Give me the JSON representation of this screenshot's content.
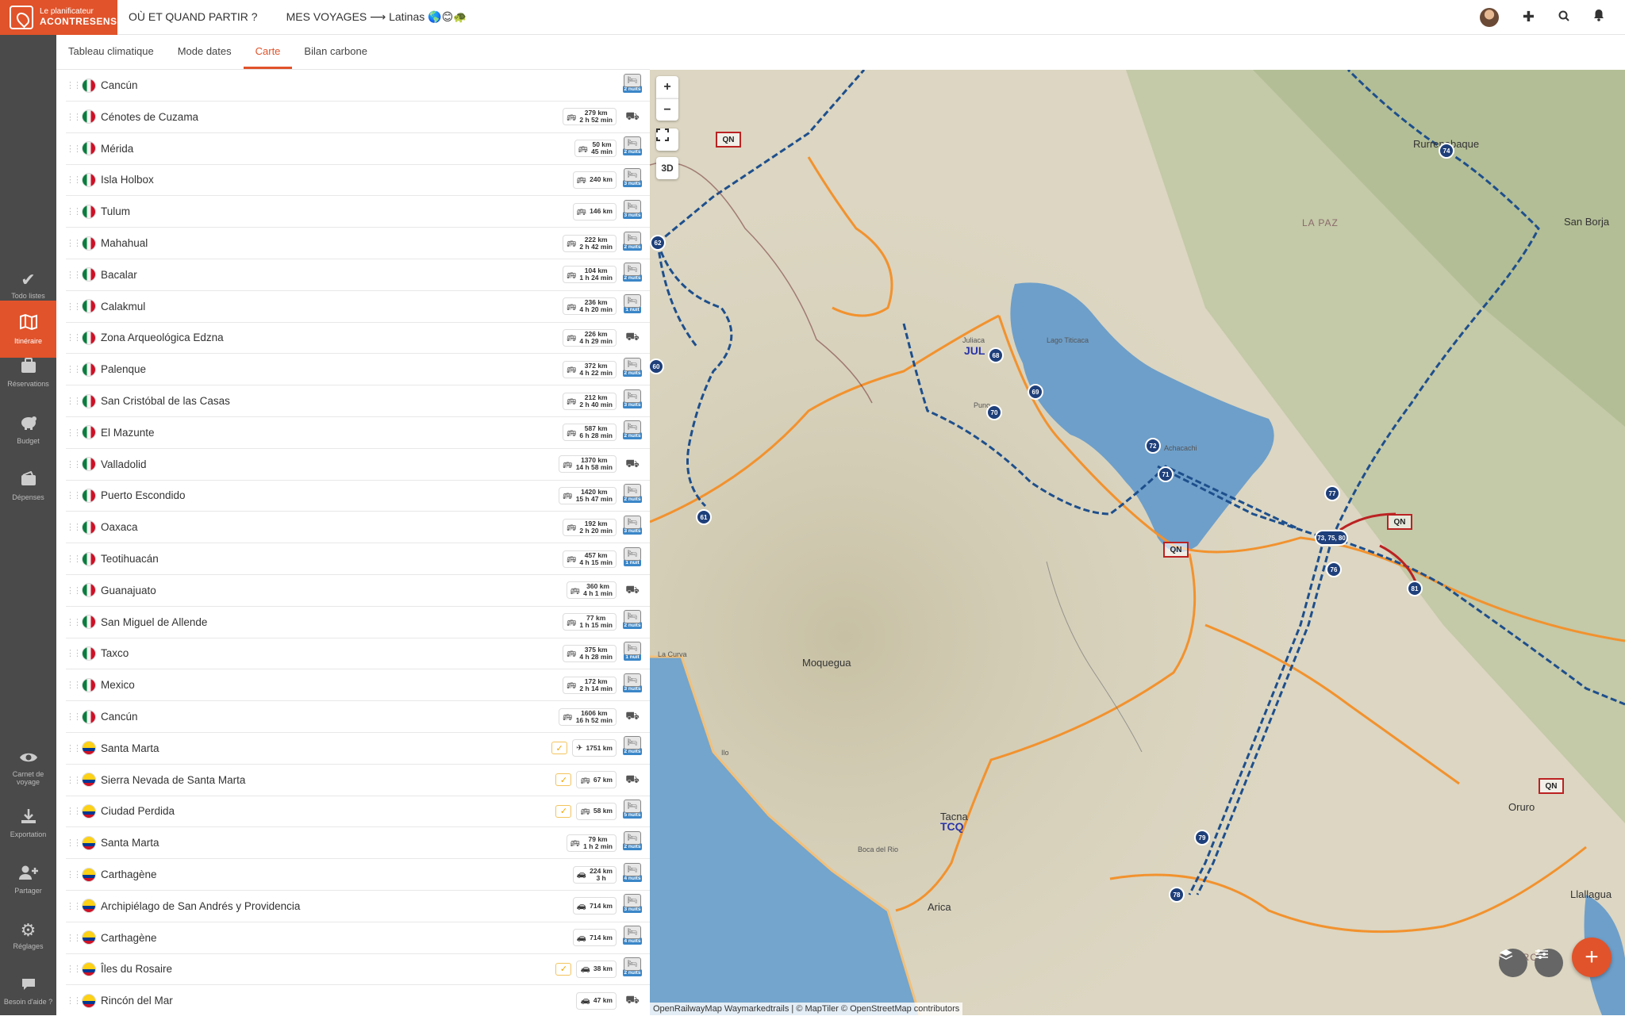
{
  "app": {
    "logo_line1": "Le planificateur",
    "logo_line2": "ACONTRESENS"
  },
  "topnav": {
    "where_when": "OÙ ET QUAND PARTIR ?",
    "my_trips": "MES VOYAGES ⟶ Latinas 🌎😊🐢"
  },
  "topbar_icons": [
    "avatar",
    "plus-icon",
    "search-icon",
    "bell-icon"
  ],
  "sidebar": {
    "items": [
      {
        "label": "Todo listes",
        "icon": "check-icon"
      },
      {
        "label": "Itinéraire",
        "icon": "map-icon",
        "active": true
      },
      {
        "label": "Réservations",
        "icon": "suitcase-icon"
      },
      {
        "label": "Budget",
        "icon": "piggy-bank-icon"
      },
      {
        "label": "Dépenses",
        "icon": "wallet-icon"
      },
      {
        "label": "Carnet de voyage",
        "icon": "eye-icon"
      },
      {
        "label": "Exportation",
        "icon": "download-icon"
      },
      {
        "label": "Partager",
        "icon": "add-user-icon"
      },
      {
        "label": "Réglages",
        "icon": "gear-icon"
      },
      {
        "label": "Besoin d'aide ?",
        "icon": "chat-icon"
      }
    ]
  },
  "tabs": [
    {
      "label": "Tableau climatique"
    },
    {
      "label": "Mode dates"
    },
    {
      "label": "Carte",
      "active": true
    },
    {
      "label": "Bilan carbone"
    }
  ],
  "colors": {
    "brand": "#e1532a",
    "green": "#7bbf5a",
    "yellow": "#f4e04d",
    "orange": "#f0a35a",
    "red": "#e25b4a",
    "route_blue": "#1e4f8c",
    "route_orange": "#f2922e"
  },
  "itinerary": [
    {
      "place": "Cancún",
      "flag": "mx",
      "check": false,
      "transport": null,
      "dist": "",
      "time": "",
      "nights": "2 nuits",
      "num": "1",
      "color": "#f6ec8a",
      "numcolor": "#8a7a1a"
    },
    {
      "place": "Cénotes de Cuzama",
      "flag": "mx",
      "check": false,
      "transport": "bus",
      "dist": "279 km",
      "time": "2 h 52 min",
      "nights": "",
      "num": "2",
      "color": "#7bbf5a"
    },
    {
      "place": "Mérida",
      "flag": "mx",
      "check": false,
      "transport": "bus",
      "dist": "50 km",
      "time": "45 min",
      "nights": "2 nuits",
      "num": "3",
      "color": "#7bbf5a"
    },
    {
      "place": "Isla Holbox",
      "flag": "mx",
      "check": false,
      "transport": "bus",
      "dist": "240 km",
      "time": "",
      "nights": "3 nuits",
      "num": "4",
      "color": "#9fd08a"
    },
    {
      "place": "Tulum",
      "flag": "mx",
      "check": false,
      "transport": "bus",
      "dist": "146 km",
      "time": "",
      "nights": "3 nuits",
      "num": "5",
      "color": "#9fd08a"
    },
    {
      "place": "Mahahual",
      "flag": "mx",
      "check": false,
      "transport": "bus",
      "dist": "222 km",
      "time": "2 h 42 min",
      "nights": "2 nuits",
      "num": "6",
      "color": "#7bbf5a"
    },
    {
      "place": "Bacalar",
      "flag": "mx",
      "check": false,
      "transport": "bus",
      "dist": "104 km",
      "time": "1 h 24 min",
      "nights": "2 nuits",
      "num": "7",
      "color": "#7bbf5a"
    },
    {
      "place": "Calakmul",
      "flag": "mx",
      "check": false,
      "transport": "bus",
      "dist": "236 km",
      "time": "4 h 20 min",
      "nights": "1 nuit",
      "num": "8",
      "color": "#7bbf5a"
    },
    {
      "place": "Zona Arqueológica Edzna",
      "flag": "mx",
      "check": false,
      "transport": "bus",
      "dist": "226 km",
      "time": "4 h 29 min",
      "nights": "",
      "num": "9",
      "color": "#7bbf5a"
    },
    {
      "place": "Palenque",
      "flag": "mx",
      "check": false,
      "transport": "bus",
      "dist": "372 km",
      "time": "4 h 22 min",
      "nights": "2 nuits",
      "num": "10",
      "color": "#7bbf5a"
    },
    {
      "place": "San Cristóbal de las Casas",
      "flag": "mx",
      "check": false,
      "transport": "bus",
      "dist": "212 km",
      "time": "2 h 40 min",
      "nights": "3 nuits",
      "num": "11",
      "color": "#f6ec8a",
      "numcolor": "#8a7a1a"
    },
    {
      "place": "El Mazunte",
      "flag": "mx",
      "check": false,
      "transport": "bus",
      "dist": "587 km",
      "time": "6 h 28 min",
      "nights": "2 nuits",
      "num": "12",
      "color": "#7bbf5a"
    },
    {
      "place": "Valladolid",
      "flag": "mx",
      "check": false,
      "transport": "bus",
      "dist": "1370 km",
      "time": "14 h 58 min",
      "nights": "",
      "num": "13",
      "color": "#7bbf5a"
    },
    {
      "place": "Puerto Escondido",
      "flag": "mx",
      "check": false,
      "transport": "bus",
      "dist": "1420 km",
      "time": "15 h 47 min",
      "nights": "2 nuits",
      "num": "14",
      "color": "#7bbf5a"
    },
    {
      "place": "Oaxaca",
      "flag": "mx",
      "check": false,
      "transport": "bus",
      "dist": "192 km",
      "time": "2 h 20 min",
      "nights": "3 nuits",
      "num": "15",
      "color": "#9fd08a"
    },
    {
      "place": "Teotihuacán",
      "flag": "mx",
      "check": false,
      "transport": "bus",
      "dist": "457 km",
      "time": "4 h 15 min",
      "nights": "1 nuit",
      "num": "16",
      "color": "#e25b4a"
    },
    {
      "place": "Guanajuato",
      "flag": "mx",
      "check": false,
      "transport": "bus",
      "dist": "360 km",
      "time": "4 h 1 min",
      "nights": "",
      "num": "17",
      "color": "#f0a35a"
    },
    {
      "place": "San Miguel de Allende",
      "flag": "mx",
      "check": false,
      "transport": "bus",
      "dist": "77 km",
      "time": "1 h 15 min",
      "nights": "2 nuits",
      "num": "18",
      "color": "#f0a35a"
    },
    {
      "place": "Taxco",
      "flag": "mx",
      "check": false,
      "transport": "bus",
      "dist": "375 km",
      "time": "4 h 28 min",
      "nights": "1 nuit",
      "num": "19",
      "color": "#7bbf5a"
    },
    {
      "place": "Mexico",
      "flag": "mx",
      "check": false,
      "transport": "bus",
      "dist": "172 km",
      "time": "2 h 14 min",
      "nights": "3 nuits",
      "num": "20",
      "color": "#f6ec8a",
      "numcolor": "#8a7a1a"
    },
    {
      "place": "Cancún",
      "flag": "mx",
      "check": false,
      "transport": "bus",
      "dist": "1606 km",
      "time": "16 h 52 min",
      "nights": "",
      "num": "21",
      "color": "#f6ec8a",
      "numcolor": "#8a7a1a"
    },
    {
      "place": "Santa Marta",
      "flag": "co",
      "check": true,
      "transport": "plane",
      "dist": "1751 km",
      "time": "",
      "nights": "2 nuits",
      "num": "22",
      "color": "#7bbf5a"
    },
    {
      "place": "Sierra Nevada de Santa Marta",
      "flag": "co",
      "check": true,
      "transport": "bus",
      "dist": "67 km",
      "time": "",
      "nights": "",
      "num": "23",
      "color": "#7bbf5a"
    },
    {
      "place": "Ciudad Perdida",
      "flag": "co",
      "check": true,
      "transport": "bus",
      "dist": "58 km",
      "time": "",
      "nights": "5 nuits",
      "num": "24",
      "color": "#7bbf5a"
    },
    {
      "place": "Santa Marta",
      "flag": "co",
      "check": false,
      "transport": "bus",
      "dist": "79 km",
      "time": "1 h 2 min",
      "nights": "2 nuits",
      "num": "25",
      "color": "#7bbf5a"
    },
    {
      "place": "Carthagène",
      "flag": "co",
      "check": false,
      "transport": "car",
      "dist": "224 km",
      "time": "3 h",
      "nights": "4 nuits",
      "num": "26",
      "color": "#7bbf5a"
    },
    {
      "place": "Archipiélago de San Andrés y Providencia",
      "flag": "co",
      "check": false,
      "transport": "car",
      "dist": "714 km",
      "time": "",
      "nights": "3 nuits",
      "num": "27",
      "color": "#7bbf5a"
    },
    {
      "place": "Carthagène",
      "flag": "co",
      "check": false,
      "transport": "car",
      "dist": "714 km",
      "time": "",
      "nights": "4 nuits",
      "num": "28",
      "color": "#7bbf5a"
    },
    {
      "place": "Îles du Rosaire",
      "flag": "co",
      "check": true,
      "transport": "car",
      "dist": "38 km",
      "time": "",
      "nights": "2 nuits",
      "num": "29",
      "color": "#7bbf5a"
    },
    {
      "place": "Rincón del Mar",
      "flag": "co",
      "check": false,
      "transport": "car",
      "dist": "47 km",
      "time": "",
      "nights": "",
      "num": "30",
      "color": "#7bbf5a"
    }
  ],
  "map": {
    "controls": {
      "zoom_in": "+",
      "zoom_out": "−",
      "three_d": "3D"
    },
    "attribution": "OpenRailwayMap Waymarkedtrails | © MapTiler © OpenStreetMap contributors",
    "labels": {
      "moquegua": "Moquegua",
      "la_paz": "LA PAZ",
      "san_borja": "San Borja",
      "rurrenabaque": "Rurrenabaque",
      "oruro_city": "Oruro",
      "oruro_region": "ORURO",
      "llallagua": "Llallagua",
      "tacna": "Tacna",
      "arica": "Arica",
      "tcq": "TCQ",
      "jul": "JUL",
      "juliaca": "Juliaca",
      "puno": "Puno",
      "lago": "Lago Titicaca",
      "achacachi": "Achacachi",
      "ilo": "Ilo",
      "la_curva": "La Curva",
      "boca_del_rio": "Boca del Rio"
    },
    "stages": [
      "61",
      "62",
      "60",
      "68",
      "69",
      "70",
      "71",
      "72",
      "73, 75, 80",
      "74",
      "76",
      "77",
      "78",
      "79",
      "81"
    ],
    "qn_marker": "QN"
  },
  "fab_label": "+"
}
